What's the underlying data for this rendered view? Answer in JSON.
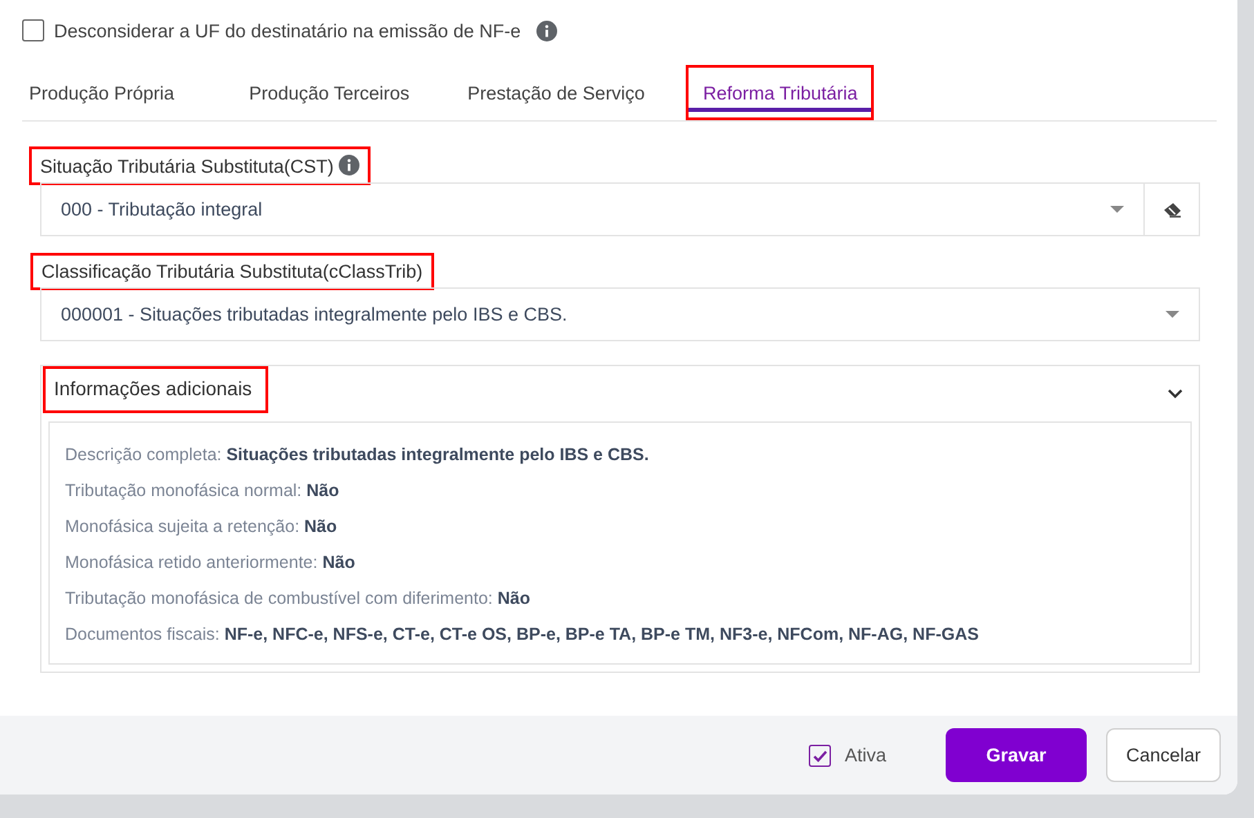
{
  "option": {
    "label": "Desconsiderar a UF do destinatário na emissão de NF-e",
    "checked": false,
    "info": true
  },
  "tabs": [
    {
      "label": "Produção Própria",
      "selected": false,
      "highlighted": false
    },
    {
      "label": "Produção Terceiros",
      "selected": false,
      "highlighted": false
    },
    {
      "label": "Prestação de Serviço",
      "selected": false,
      "highlighted": false
    },
    {
      "label": "Reforma Tributária",
      "selected": true,
      "highlighted": true
    }
  ],
  "fields": [
    {
      "label": "Situação Tributária Substituta(CST)",
      "info": true,
      "highlighted": true,
      "value": "000 - Tributação integral",
      "clearable": true
    },
    {
      "label": "Classificação Tributária Substituta(cClassTrib)",
      "info": false,
      "highlighted": true,
      "value": "000001 - Situações tributadas integralmente pelo IBS e CBS.",
      "clearable": false
    }
  ],
  "details": {
    "title": "Informações adicionais",
    "highlighted": true,
    "expanded": true,
    "rows": [
      {
        "label": "Descrição completa:",
        "value": "Situações tributadas integralmente pelo IBS e CBS."
      },
      {
        "label": "Tributação monofásica normal:",
        "value": "Não"
      },
      {
        "label": "Monofásica sujeita a retenção:",
        "value": "Não"
      },
      {
        "label": "Monofásica retido anteriormente:",
        "value": "Não"
      },
      {
        "label": "Tributação monofásica de combustível com diferimento:",
        "value": "Não"
      },
      {
        "label": "Documentos fiscais:",
        "value": "NF-e, NFC-e, NFS-e, CT-e, CT-e OS, BP-e, BP-e TA, BP-e TM, NF3-e, NFCom, NF-AG, NF-GAS"
      }
    ]
  },
  "footer": {
    "active": {
      "label": "Ativa",
      "checked": true
    },
    "buttons": [
      {
        "label": "Gravar",
        "kind": "primary"
      },
      {
        "label": "Cancelar",
        "kind": "secondary"
      }
    ]
  }
}
